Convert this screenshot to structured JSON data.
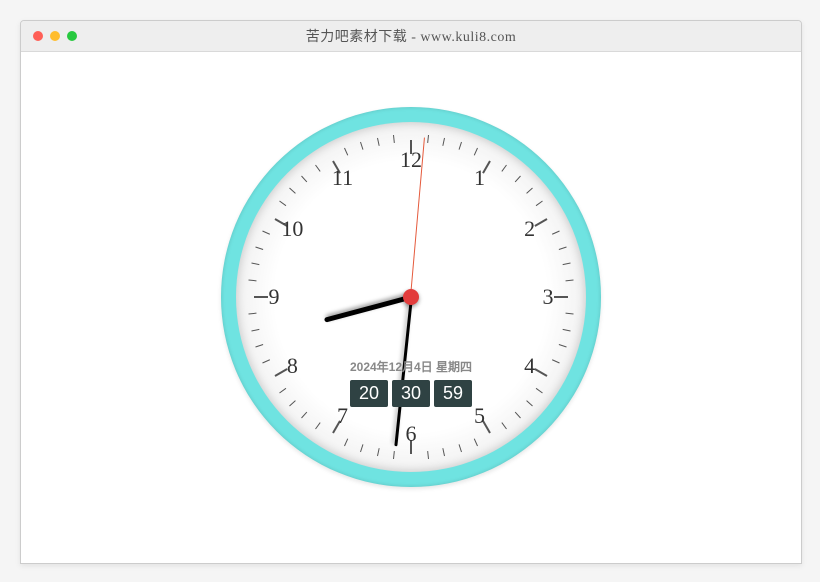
{
  "window": {
    "title": "苦力吧素材下载 - www.kuli8.com"
  },
  "clock": {
    "frame_color": "#6fe3e1",
    "numerals": [
      "12",
      "1",
      "2",
      "3",
      "4",
      "5",
      "6",
      "7",
      "8",
      "9",
      "10",
      "11"
    ],
    "date_text": "2024年12月4日 星期四",
    "digital": {
      "hours": "20",
      "minutes": "30",
      "seconds": "59"
    },
    "hands": {
      "hour_deg": 255,
      "minute_deg": 186,
      "second_deg": 5
    }
  }
}
